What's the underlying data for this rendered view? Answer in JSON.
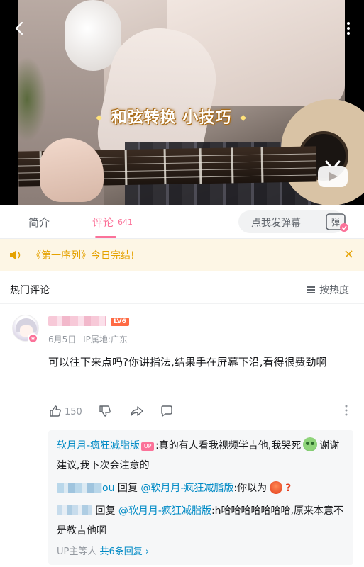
{
  "video": {
    "caption_text": "和弦转换 小技巧",
    "spark": "✦"
  },
  "tabs": {
    "intro": "简介",
    "comments": "评论",
    "comments_count": "641",
    "danmaku_placeholder": "点我发弹幕",
    "danmaku_button": "弹"
  },
  "notice": {
    "text": "《第一序列》今日完结!",
    "close": "×"
  },
  "hot_header": {
    "title": "热门评论",
    "sort_label": "按热度"
  },
  "comment": {
    "level": "LV6",
    "date": "6月5日",
    "ip_location": "IP属地:广东",
    "body": "可以往下来点吗?你讲指法,结果手在屏幕下沿,看得很费劲啊",
    "likes": "150"
  },
  "replies": {
    "r1_author": "软月月-疯狂减脂版",
    "r1_up_badge": "UP",
    "r1_text_a": ":真的有人看我视频学吉他,我哭死",
    "r1_text_b": "谢谢建议,我下次会注意的",
    "r2_name_suffix": "ou",
    "r2_reply_word": "回复",
    "r2_mention": "@软月月-疯狂减脂版",
    "r2_text": ":你以为",
    "r2_qmark": "?",
    "r3_reply_word": "回复",
    "r3_mention": "@软月月-疯狂减脂版",
    "r3_text": ":h哈哈哈哈哈哈哈,原来本意不是教吉他啊",
    "footer_prefix": "UP主等人",
    "footer_link": "共6条回复",
    "footer_arrow": "›"
  },
  "colors": {
    "accent_pink": "#fb7299",
    "link_blue": "#008ac5",
    "notice_yellow": "#e5a200",
    "level_orange": "#ff6b45"
  },
  "icons": [
    "back-arrow-icon",
    "more-vertical-icon",
    "tv-logo-icon",
    "speaker-icon",
    "close-icon",
    "sort-icon",
    "thumb-up-icon",
    "thumb-down-icon",
    "share-icon",
    "reply-bubble-icon",
    "cry-emoji-icon",
    "angry-emoji-icon"
  ]
}
